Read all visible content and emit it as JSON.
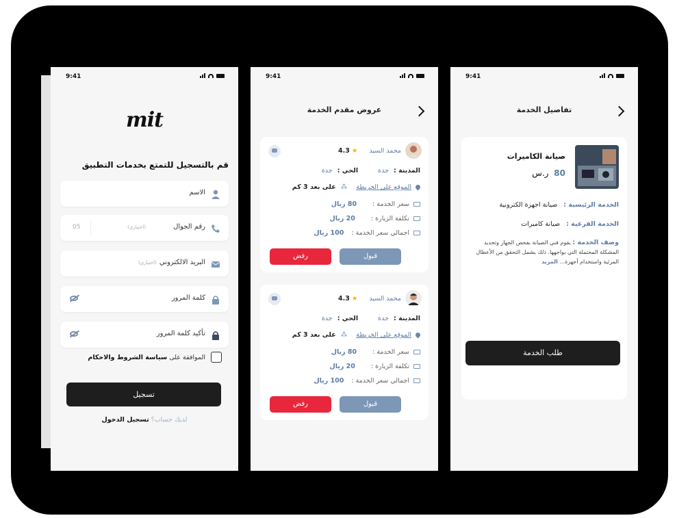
{
  "status": {
    "time": "9:41"
  },
  "register": {
    "logo": "mit",
    "title": "قم بالتسجيل للتمتع بخدمات التطبيق",
    "fields": {
      "name": "الاسم",
      "phone": "رقم الجوال",
      "phone_optional": "(اختياري)",
      "phone_code": "05",
      "email": "البريد الالكتروني",
      "email_optional": "(اختياري)",
      "password": "كلمة المرور",
      "confirm_password": "تأكيد كلمة المرور"
    },
    "agree_prefix": "الموافقة على ",
    "agree_link": "سياسة الشروط والاحكام",
    "submit": "تسجيل",
    "have_account": "لديك حساب؟ ",
    "login": "تسجيل الدخول"
  },
  "offers": {
    "title": "عروض مقدم الخدمة",
    "labels": {
      "city": "المدينة :",
      "district": "الحي :",
      "map": "الموقع على الخريطة",
      "price": "سعر الخدمة :",
      "visit": "تكلفة الزيارة :",
      "total": "اجمالي سعر الخدمة :",
      "accept": "قبول",
      "reject": "رفض"
    },
    "cards": [
      {
        "name": "محمد السيد",
        "rating": "4.3",
        "city": "جدة",
        "district": "جدة",
        "distance": "على بعد 3 كم",
        "price": "80 ريال",
        "visit": "20 ريال",
        "total": "100 ريال"
      },
      {
        "name": "محمد السيد",
        "rating": "4.3",
        "city": "جدة",
        "district": "جدة",
        "distance": "على بعد 3 كم",
        "price": "80 ريال",
        "visit": "20 ريال",
        "total": "100 ريال"
      }
    ]
  },
  "details": {
    "title": "تفاصيل الخدمة",
    "service_name": "صيانة الكاميرات",
    "price": "80",
    "currency": "ر.س",
    "main_label": "الخدمة الرئيسية :",
    "main_value": "صيانة اجهزة الكترونية",
    "sub_label": "الخدمة الفرعية :",
    "sub_value": "صيانة كاميرات",
    "desc_label": "وصف الخدمة :",
    "desc_text": "يقوم فني الصيانة بفحص الجهاز وتحديد المشكلة المحتملة التي يواجهها. ذلك يشمل التحقق من الأعطال المرئية واستخدام أجهزة...",
    "more": "المزيد",
    "request": "طلب الخدمة"
  },
  "colors": {
    "accent": "#5d7ca6",
    "dark": "#1e1e1f",
    "reject": "#e8273c",
    "accept": "#7d97b7",
    "star": "#f4b400"
  }
}
